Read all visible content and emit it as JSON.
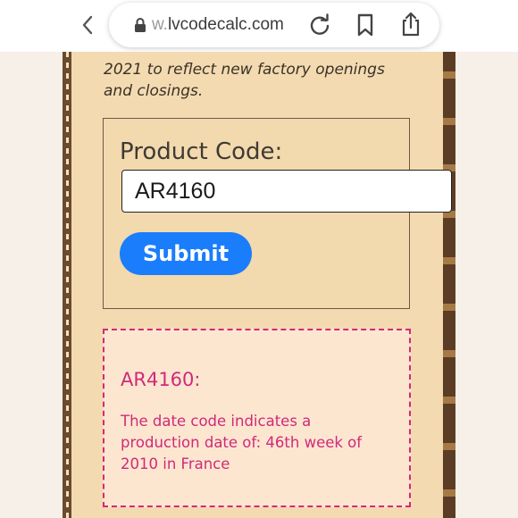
{
  "browser": {
    "url_prefix": "w.",
    "url_domain": "lvcodecalc.com"
  },
  "page": {
    "intro_text": "2021 to reflect new factory openings and closings.",
    "form": {
      "label": "Product Code:",
      "input_value": "AR4160",
      "submit_label": "Submit"
    },
    "result": {
      "code_heading": "AR4160:",
      "description": "The date code indicates a production date of: 46th week of 2010 in France"
    }
  },
  "colors": {
    "page_background": "#f3dab0",
    "submit_button": "#1a7dfb",
    "result_accent": "#cf2a7b",
    "result_background": "#fde6cf"
  },
  "icons": {
    "back": "chevron-left-icon",
    "lock": "lock-icon",
    "reload": "reload-icon",
    "bookmark": "bookmark-icon",
    "share": "share-icon"
  }
}
